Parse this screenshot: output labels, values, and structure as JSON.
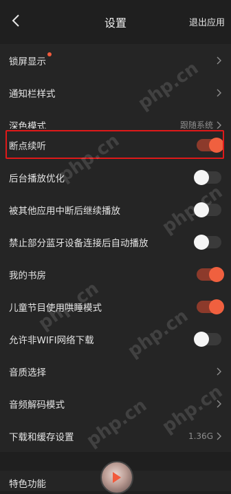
{
  "header": {
    "title": "设置",
    "exit_label": "退出应用"
  },
  "group1": [
    {
      "label": "锁屏显示",
      "dot": true
    },
    {
      "label": "通知栏样式"
    },
    {
      "label": "深色模式",
      "value": "跟随系统"
    }
  ],
  "group2": [
    {
      "label": "断点续听",
      "on": true
    },
    {
      "label": "后台播放优化",
      "on": false
    },
    {
      "label": "被其他应用中断后继续播放",
      "on": false
    },
    {
      "label": "禁止部分蓝牙设备连接后自动播放",
      "on": false
    },
    {
      "label": "我的书房",
      "on": true
    },
    {
      "label": "儿童节目使用哄睡模式",
      "on": true
    },
    {
      "label": "允许非WIFI网络下载",
      "on": false
    },
    {
      "label": "音质选择"
    },
    {
      "label": "音频解码模式"
    },
    {
      "label": "下载和缓存设置",
      "value": "1.36G"
    }
  ],
  "bottom": {
    "label": "特色功能"
  },
  "watermark": "php.cn",
  "colors": {
    "accent": "#f0603f",
    "highlight_border": "#e01919"
  }
}
